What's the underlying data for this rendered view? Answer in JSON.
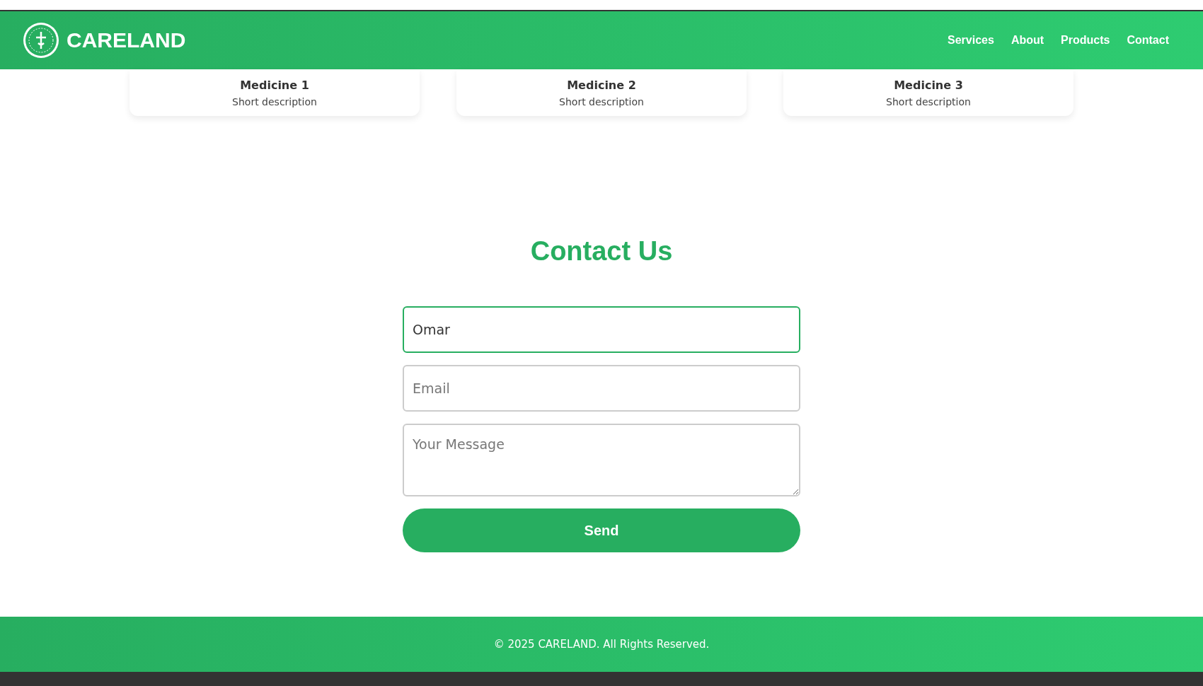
{
  "header": {
    "brand": "CARELAND",
    "nav": [
      {
        "label": "Services"
      },
      {
        "label": "About"
      },
      {
        "label": "Products"
      },
      {
        "label": "Contact"
      }
    ]
  },
  "products": [
    {
      "name": "Medicine 1",
      "description": "Short description"
    },
    {
      "name": "Medicine 2",
      "description": "Short description"
    },
    {
      "name": "Medicine 3",
      "description": "Short description"
    }
  ],
  "contact": {
    "title": "Contact Us",
    "name_field": {
      "value": "Omar",
      "focused": true
    },
    "email_field": {
      "placeholder": "Email"
    },
    "message_field": {
      "placeholder": "Your Message"
    },
    "button": "Send"
  },
  "footer": {
    "text": "© 2025 CARELAND. All Rights Reserved."
  }
}
